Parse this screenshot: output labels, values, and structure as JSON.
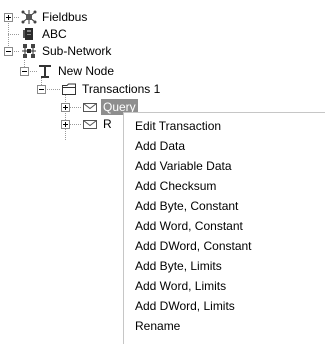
{
  "tree": {
    "nodes": [
      {
        "label": "Fieldbus",
        "icon": "fieldbus-icon",
        "expander": "plus"
      },
      {
        "label": "ABC",
        "icon": "device-icon",
        "expander": "none"
      },
      {
        "label": "Sub-Network",
        "icon": "subnetwork-icon",
        "expander": "minus"
      },
      {
        "label": "New Node",
        "icon": "node-icon",
        "expander": "minus"
      },
      {
        "label": "Transactions 1",
        "icon": "folder-icon",
        "expander": "minus"
      },
      {
        "label": "Query",
        "icon": "envelope-icon",
        "expander": "plus",
        "selected": true
      },
      {
        "label": "R",
        "icon": "envelope-icon",
        "expander": "plus"
      }
    ]
  },
  "context_menu": {
    "items": [
      "Edit Transaction",
      "Add Data",
      "Add Variable Data",
      "Add Checksum",
      "Add Byte, Constant",
      "Add Word, Constant",
      "Add DWord, Constant",
      "Add Byte, Limits",
      "Add Word, Limits",
      "Add DWord, Limits",
      "Rename"
    ]
  },
  "colors": {
    "selection": "#8e8e8e",
    "tree_lines": "#9a9a9a",
    "menu_border": "#c6c6c6"
  }
}
